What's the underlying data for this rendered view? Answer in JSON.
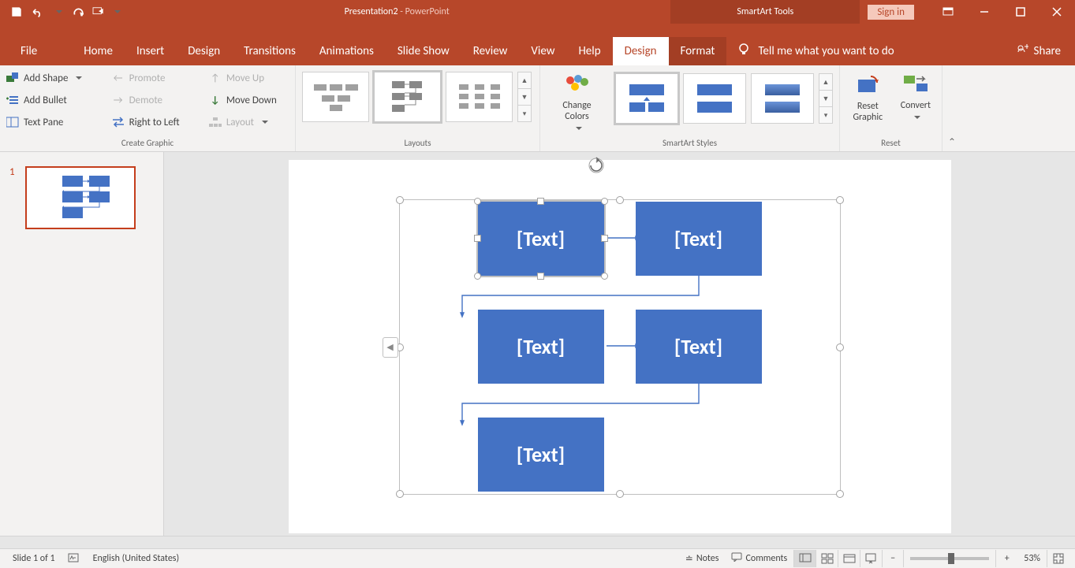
{
  "title": {
    "doc": "Presentation2",
    "sep": " - ",
    "app": "PowerPoint"
  },
  "tooltab": "SmartArt Tools",
  "signin": "Sign in",
  "tabs": {
    "file": "File",
    "home": "Home",
    "insert": "Insert",
    "design_main": "Design",
    "transitions": "Transitions",
    "animations": "Animations",
    "slideshow": "Slide Show",
    "review": "Review",
    "view": "View",
    "help": "Help",
    "sa_design": "Design",
    "sa_format": "Format",
    "tellme": "Tell me what you want to do",
    "share": "Share"
  },
  "ribbon": {
    "create": {
      "add_shape": "Add Shape",
      "add_bullet": "Add Bullet",
      "text_pane": "Text Pane",
      "promote": "Promote",
      "demote": "Demote",
      "rtl": "Right to Left",
      "move_up": "Move Up",
      "move_down": "Move Down",
      "layout": "Layout",
      "label": "Create Graphic"
    },
    "layouts_label": "Layouts",
    "change_colors": "Change Colors",
    "styles_label": "SmartArt Styles",
    "reset_graphic": "Reset Graphic",
    "convert": "Convert",
    "reset_label": "Reset"
  },
  "thumbs": {
    "n1": "1"
  },
  "smartart": {
    "b1": "[Text]",
    "b2": "[Text]",
    "b3": "[Text]",
    "b4": "[Text]",
    "b5": "[Text]"
  },
  "status": {
    "slide": "Slide 1 of 1",
    "lang": "English (United States)",
    "notes": "Notes",
    "comments": "Comments",
    "zoom": "53%"
  }
}
